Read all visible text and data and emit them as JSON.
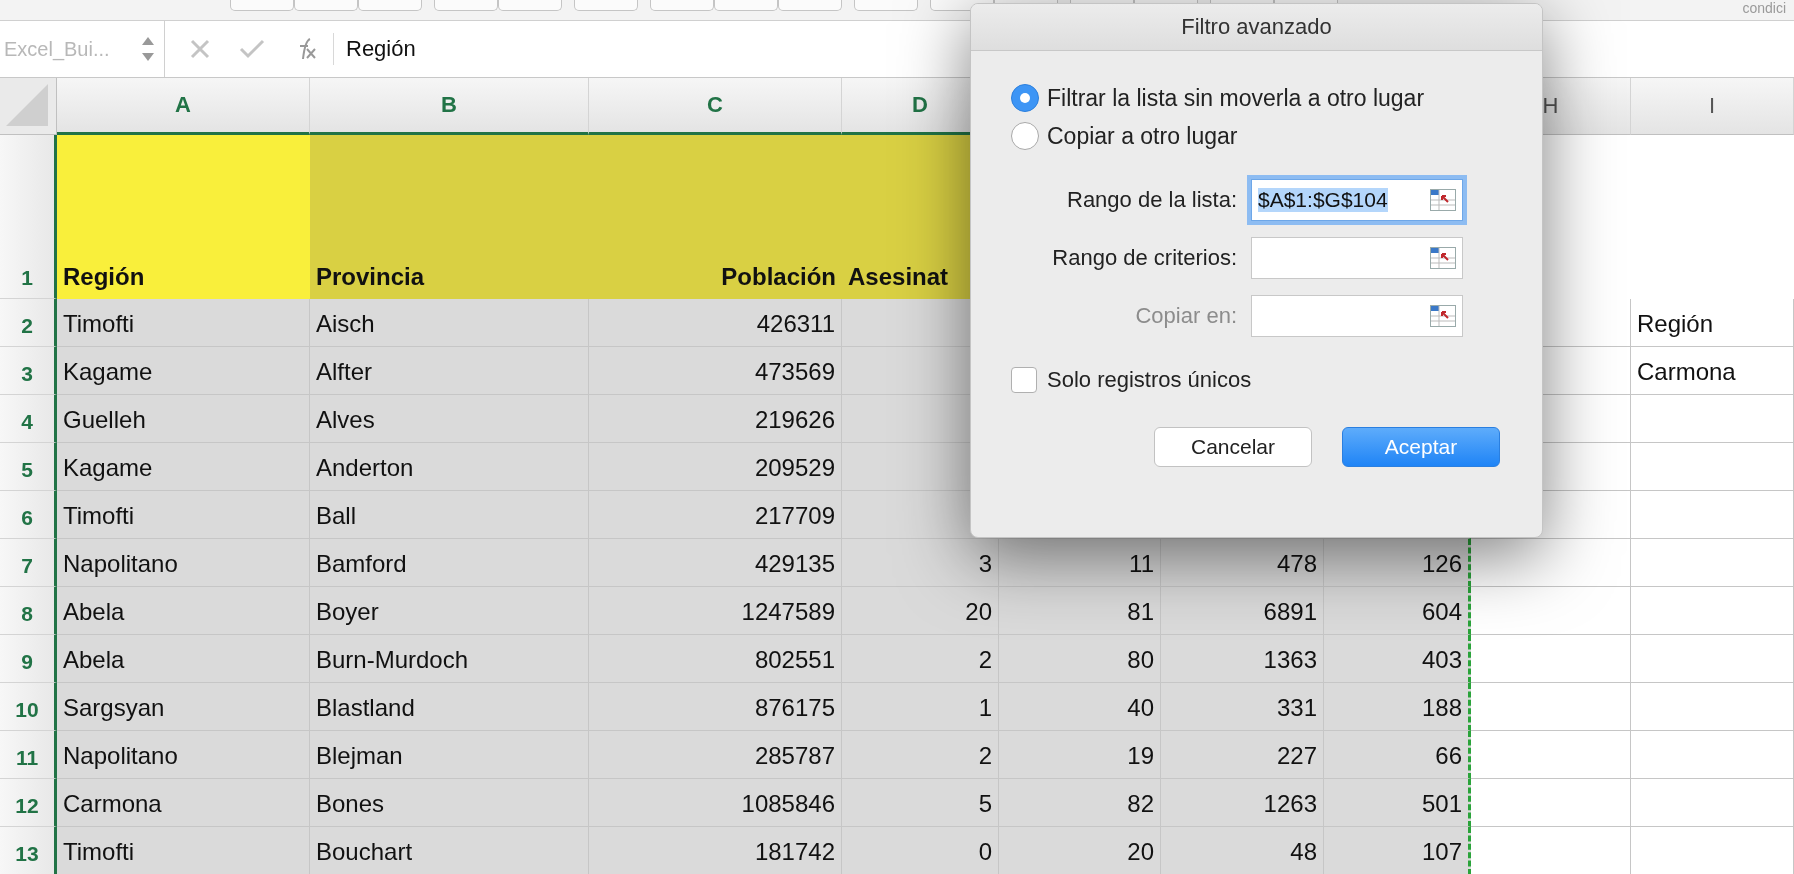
{
  "ribbon": {
    "text": "condici"
  },
  "formula_bar": {
    "name_box": "Excel_Bui...",
    "formula": "Región"
  },
  "columns": [
    {
      "letter": "A",
      "selected": true,
      "color": "#f9ef3b",
      "kind": "text"
    },
    {
      "letter": "B",
      "selected": true,
      "color": "#d9d043",
      "kind": "text"
    },
    {
      "letter": "C",
      "selected": true,
      "color": "#d9d043",
      "kind": "number"
    },
    {
      "letter": "D",
      "selected": true,
      "color": "#d9d043",
      "kind": "number"
    },
    {
      "selected": true,
      "kind": "number"
    },
    {
      "selected": true,
      "kind": "number"
    },
    {
      "selected": true,
      "kind": "number"
    },
    {
      "letter": "H",
      "selected": false,
      "kind": "text"
    },
    {
      "letter": "I",
      "selected": false,
      "kind": "text"
    }
  ],
  "header_row": {
    "number": "1",
    "cells": [
      {
        "text": "Región",
        "kind": "text"
      },
      {
        "text": "Provincia",
        "kind": "text"
      },
      {
        "text": "Población",
        "kind": "number"
      },
      {
        "text": "Asesinat",
        "kind": "text"
      },
      null,
      null,
      null,
      null,
      null
    ]
  },
  "rows": [
    {
      "number": "2",
      "cells": [
        "Timofti",
        "Aisch",
        "426311",
        null,
        null,
        null,
        null,
        null,
        "Región"
      ]
    },
    {
      "number": "3",
      "cells": [
        "Kagame",
        "Alfter",
        "473569",
        null,
        null,
        null,
        null,
        null,
        "Carmona"
      ]
    },
    {
      "number": "4",
      "cells": [
        "Guelleh",
        "Alves",
        "219626",
        null,
        null,
        null,
        null,
        null,
        null
      ]
    },
    {
      "number": "5",
      "cells": [
        "Kagame",
        "Anderton",
        "209529",
        null,
        null,
        null,
        null,
        null,
        null
      ]
    },
    {
      "number": "6",
      "cells": [
        "Timofti",
        "Ball",
        "217709",
        null,
        null,
        null,
        null,
        null,
        null
      ]
    },
    {
      "number": "7",
      "cells": [
        "Napolitano",
        "Bamford",
        "429135",
        "3",
        "11",
        "478",
        "126",
        null,
        null
      ]
    },
    {
      "number": "8",
      "cells": [
        "Abela",
        "Boyer",
        "1247589",
        "20",
        "81",
        "6891",
        "604",
        null,
        null
      ]
    },
    {
      "number": "9",
      "cells": [
        "Abela",
        "Burn-Murdoch",
        "802551",
        "2",
        "80",
        "1363",
        "403",
        null,
        null
      ]
    },
    {
      "number": "10",
      "cells": [
        "Sargsyan",
        "Blastland",
        "876175",
        "1",
        "40",
        "331",
        "188",
        null,
        null
      ]
    },
    {
      "number": "11",
      "cells": [
        "Napolitano",
        "Blejman",
        "285787",
        "2",
        "19",
        "227",
        "66",
        null,
        null
      ]
    },
    {
      "number": "12",
      "cells": [
        "Carmona",
        "Bones",
        "1085846",
        "5",
        "82",
        "1263",
        "501",
        null,
        null
      ]
    },
    {
      "number": "13",
      "cells": [
        "Timofti",
        "Bouchart",
        "181742",
        "0",
        "20",
        "48",
        "107",
        null,
        null
      ]
    }
  ],
  "dialog": {
    "title": "Filtro avanzado",
    "options": [
      {
        "label": "Filtrar la lista sin moverla a otro lugar",
        "selected": true
      },
      {
        "label": "Copiar a otro lugar",
        "selected": false
      }
    ],
    "fields": [
      {
        "label": "Rango de la lista:",
        "value": "$A$1:$G$104",
        "focused": true,
        "disabled": false
      },
      {
        "label": "Rango de criterios:",
        "focused": false,
        "disabled": false
      },
      {
        "label": "Copiar en:",
        "focused": false,
        "disabled": true
      }
    ],
    "unique_only": {
      "label": "Solo registros únicos",
      "checked": false
    },
    "buttons": [
      {
        "label": "Cancelar",
        "kind": "secondary"
      },
      {
        "label": "Aceptar",
        "kind": "primary"
      }
    ]
  }
}
